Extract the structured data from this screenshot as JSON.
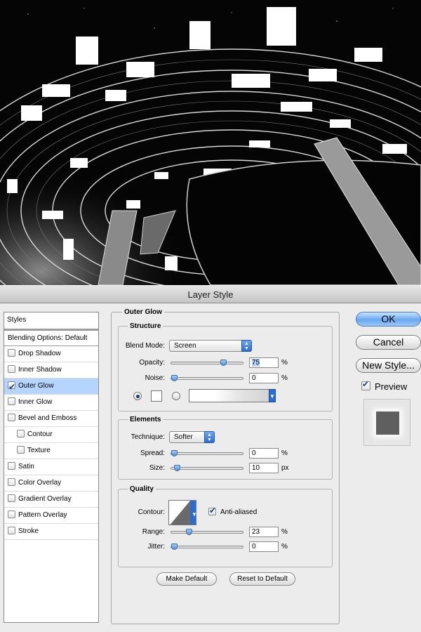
{
  "dialog": {
    "title": "Layer Style"
  },
  "styles": {
    "header": "Styles",
    "blending": "Blending Options: Default",
    "items": [
      {
        "label": "Drop Shadow",
        "checked": false
      },
      {
        "label": "Inner Shadow",
        "checked": false
      },
      {
        "label": "Outer Glow",
        "checked": true
      },
      {
        "label": "Inner Glow",
        "checked": false
      },
      {
        "label": "Bevel and Emboss",
        "checked": false
      },
      {
        "label": "Contour",
        "checked": false
      },
      {
        "label": "Texture",
        "checked": false
      },
      {
        "label": "Satin",
        "checked": false
      },
      {
        "label": "Color Overlay",
        "checked": false
      },
      {
        "label": "Gradient Overlay",
        "checked": false
      },
      {
        "label": "Pattern Overlay",
        "checked": false
      },
      {
        "label": "Stroke",
        "checked": false
      }
    ]
  },
  "outer_glow": {
    "title": "Outer Glow",
    "structure": {
      "title": "Structure",
      "blend_mode_label": "Blend Mode:",
      "blend_mode_value": "Screen",
      "opacity_label": "Opacity:",
      "opacity_value": "75",
      "noise_label": "Noise:",
      "noise_value": "0",
      "percent": "%"
    },
    "elements": {
      "title": "Elements",
      "technique_label": "Technique:",
      "technique_value": "Softer",
      "spread_label": "Spread:",
      "spread_value": "0",
      "size_label": "Size:",
      "size_value": "10",
      "px": "px",
      "percent": "%"
    },
    "quality": {
      "title": "Quality",
      "contour_label": "Contour:",
      "anti_aliased_label": "Anti-aliased",
      "anti_aliased": true,
      "range_label": "Range:",
      "range_value": "23",
      "jitter_label": "Jitter:",
      "jitter_value": "0",
      "percent": "%"
    },
    "make_default": "Make Default",
    "reset_default": "Reset to Default"
  },
  "buttons": {
    "ok": "OK",
    "cancel": "Cancel",
    "new_style": "New Style...",
    "preview": "Preview"
  },
  "colors": {
    "accent": "#6ba7ee",
    "selection": "#b5d5ff"
  }
}
